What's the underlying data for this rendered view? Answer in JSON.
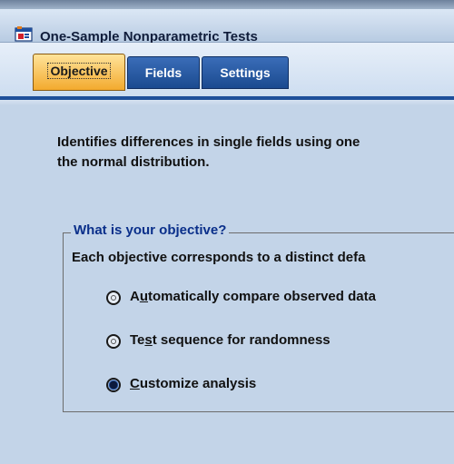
{
  "window": {
    "title": "One-Sample Nonparametric Tests"
  },
  "tabs": [
    {
      "label": "Objective",
      "selected": true
    },
    {
      "label": "Fields",
      "selected": false
    },
    {
      "label": "Settings",
      "selected": false
    }
  ],
  "description": {
    "line1": "Identifies differences in single fields using one",
    "line2": "the normal distribution."
  },
  "objective_group": {
    "legend": "What is your objective?",
    "intro": "Each objective corresponds to a distinct defa",
    "options": [
      {
        "label": "Automatically compare observed data",
        "mnemonic_before": "A",
        "mnemonic": "u",
        "mnemonic_after": "tomatically compare observed data",
        "checked": false
      },
      {
        "label": "Test sequence for randomness",
        "mnemonic_before": "Te",
        "mnemonic": "s",
        "mnemonic_after": "t sequence for randomness",
        "checked": false
      },
      {
        "label": "Customize analysis",
        "mnemonic_before": "",
        "mnemonic": "C",
        "mnemonic_after": "ustomize analysis",
        "checked": true
      }
    ]
  },
  "colors": {
    "panel_background": "#c3d4e8",
    "selected_tab": "#f3aa2e",
    "tab": "#1b4a90",
    "legend_text": "#0a2f8a"
  },
  "icons": {
    "app": "spss-dialog-icon"
  }
}
